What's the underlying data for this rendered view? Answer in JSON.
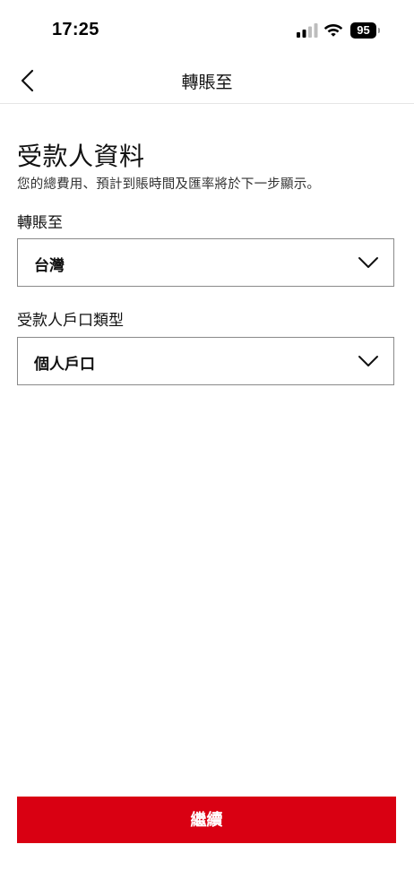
{
  "status_bar": {
    "time": "17:25",
    "battery_level": "95",
    "signal_icon": "cellular-signal-icon",
    "wifi_icon": "wifi-icon",
    "battery_icon": "battery-icon"
  },
  "header": {
    "back_icon": "chevron-left-icon",
    "title": "轉賬至"
  },
  "main": {
    "heading": "受款人資料",
    "subtitle": "您的總費用、預計到賬時間及匯率將於下一步顯示。",
    "fields": [
      {
        "label": "轉賬至",
        "value": "台灣",
        "icon": "chevron-down-icon"
      },
      {
        "label": "受款人戶口類型",
        "value": "個人戶口",
        "icon": "chevron-down-icon"
      }
    ]
  },
  "footer": {
    "continue_label": "繼續"
  },
  "colors": {
    "accent": "#d90012",
    "border": "#8a8a8a",
    "divider": "#e6e6e6",
    "text": "#111111"
  }
}
